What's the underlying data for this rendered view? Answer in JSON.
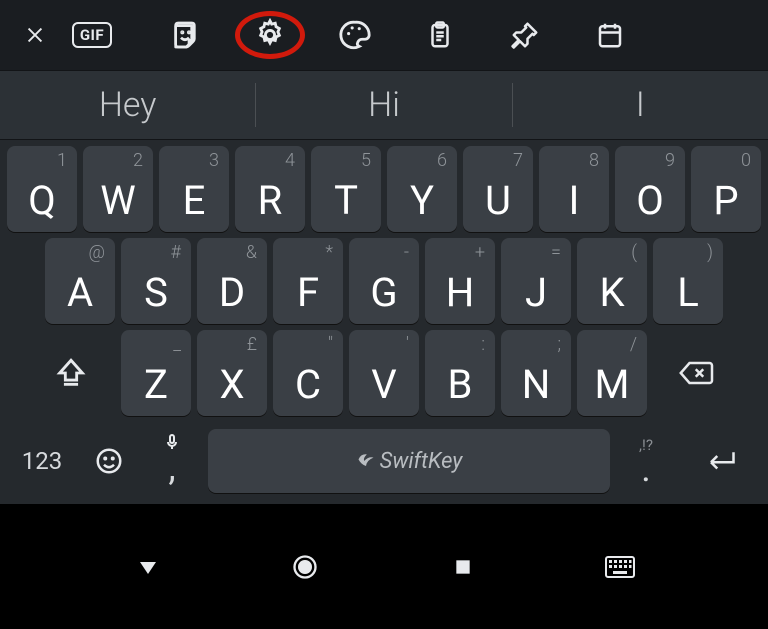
{
  "toolbar": {
    "gif_label": "GIF"
  },
  "suggestions": [
    "Hey",
    "Hi",
    "I"
  ],
  "rows": [
    [
      {
        "main": "Q",
        "sec": "1"
      },
      {
        "main": "W",
        "sec": "2"
      },
      {
        "main": "E",
        "sec": "3"
      },
      {
        "main": "R",
        "sec": "4"
      },
      {
        "main": "T",
        "sec": "5"
      },
      {
        "main": "Y",
        "sec": "6"
      },
      {
        "main": "U",
        "sec": "7"
      },
      {
        "main": "I",
        "sec": "8"
      },
      {
        "main": "O",
        "sec": "9"
      },
      {
        "main": "P",
        "sec": "0"
      }
    ],
    [
      {
        "main": "A",
        "sec": "@"
      },
      {
        "main": "S",
        "sec": "#"
      },
      {
        "main": "D",
        "sec": "&"
      },
      {
        "main": "F",
        "sec": "*"
      },
      {
        "main": "G",
        "sec": "-"
      },
      {
        "main": "H",
        "sec": "+"
      },
      {
        "main": "J",
        "sec": "="
      },
      {
        "main": "K",
        "sec": "("
      },
      {
        "main": "L",
        "sec": ")"
      }
    ],
    [
      {
        "main": "Z",
        "sec": "_"
      },
      {
        "main": "X",
        "sec": "£"
      },
      {
        "main": "C",
        "sec": "\""
      },
      {
        "main": "V",
        "sec": "'"
      },
      {
        "main": "B",
        "sec": ":"
      },
      {
        "main": "N",
        "sec": ";"
      },
      {
        "main": "M",
        "sec": "/"
      }
    ]
  ],
  "fn": {
    "numbers_label": "123",
    "comma": ",",
    "dot": ".",
    "dot_secondary": ",!?",
    "space_label": "SwiftKey"
  }
}
